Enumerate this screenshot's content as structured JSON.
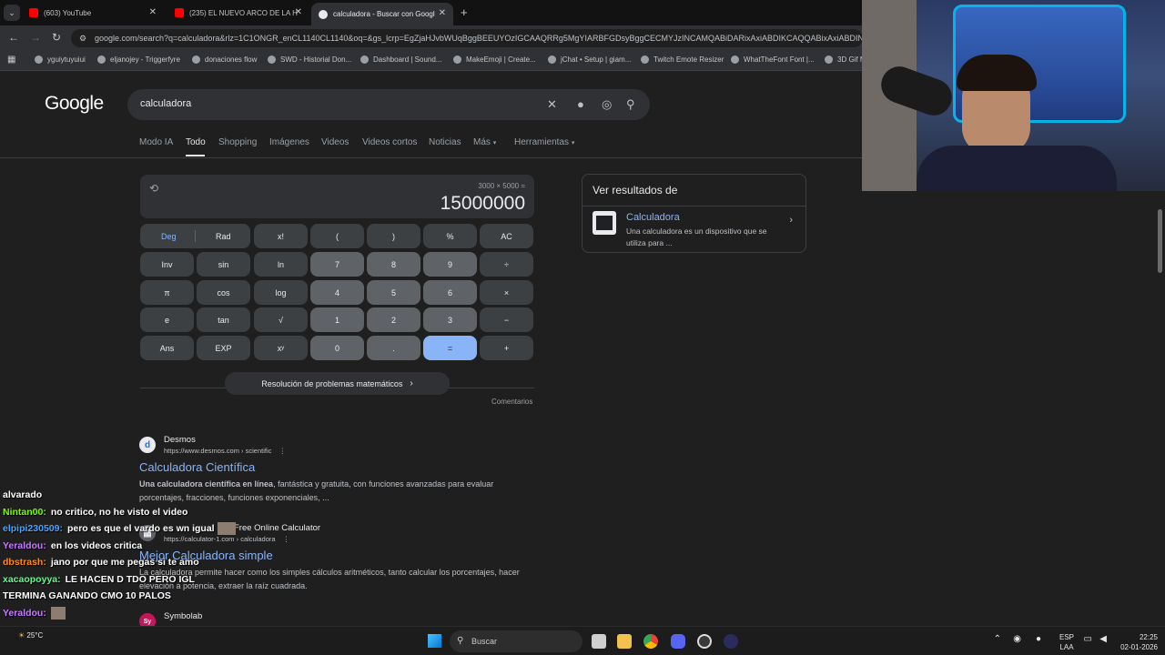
{
  "browser": {
    "tabs": [
      {
        "label": "(603) YouTube",
        "icon": "youtube-icon",
        "active": false
      },
      {
        "label": "(235) EL NUEVO ARCO DE LA H",
        "icon": "youtube-icon",
        "active": false
      },
      {
        "label": "calculadora - Buscar con Googl",
        "icon": "google-icon",
        "active": true
      }
    ],
    "url": "google.com/search?q=calculadora&rlz=1C1ONGR_enCL1140CL1140&oq=&gs_lcrp=EgZjaHJvbWUqBggBEEUYOzIGCAAQRRg5MgYIARBFGDsyBggCECMYJzINCAMQABiDARixAxiABDIKCAQQABixAxiABDINCA",
    "bookmarks": [
      "yguiytuyuiui",
      "eljanojey - Triggerfyre",
      "donaciones flow",
      "SWD - Historial Don...",
      "Dashboard | Sound...",
      "MakeEmoji | Create...",
      "jChat • Setup | giam...",
      "Twitch Emote Resizer",
      "WhatTheFont Font |...",
      "3D Gif M"
    ]
  },
  "google": {
    "logo": "Google",
    "query": "calculadora",
    "tabs": [
      "Modo IA",
      "Todo",
      "Shopping",
      "Imágenes",
      "Videos",
      "Videos cortos",
      "Noticias",
      "Más",
      "Herramientas"
    ],
    "active_tab": "Todo"
  },
  "calculator": {
    "expression": "3000 × 5000 =",
    "result": "15000000",
    "keys": {
      "deg": "Deg",
      "rad": "Rad",
      "fact": "x!",
      "lparen": "(",
      "rparen": ")",
      "percent": "%",
      "ac": "AC",
      "inv": "Inv",
      "sin": "sin",
      "ln": "ln",
      "k7": "7",
      "k8": "8",
      "k9": "9",
      "div": "÷",
      "pi": "π",
      "cos": "cos",
      "log": "log",
      "k4": "4",
      "k5": "5",
      "k6": "6",
      "mul": "×",
      "e": "e",
      "tan": "tan",
      "sqrt": "√",
      "k1": "1",
      "k2": "2",
      "k3": "3",
      "minus": "−",
      "ans": "Ans",
      "exp": "EXP",
      "pow": "xʸ",
      "k0": "0",
      "dot": ".",
      "eq": "=",
      "plus": "+"
    },
    "solve_label": "Resolución de problemas matemáticos",
    "feedback": "Comentarios"
  },
  "knowledge_panel": {
    "heading": "Ver resultados de",
    "title": "Calculadora",
    "desc": "Una calculadora es un dispositivo que se utiliza para ..."
  },
  "results": [
    {
      "site": "Desmos",
      "url": "https://www.desmos.com › scientific",
      "title": "Calculadora Científica",
      "snippet_bold": "Una calculadora científica en línea",
      "snippet": ", fantástica y gratuita, con funciones avanzadas para evaluar porcentajes, fracciones, funciones exponenciales, ..."
    },
    {
      "site": "Free Online Calculator",
      "url": "https://calculator-1.com › calculadora",
      "title": "Mejor Calculadora simple",
      "snippet": "La calculadora permite hacer como los simples cálculos aritméticos, tanto calcular los porcentajes, hacer elevación a potencia, extraer la raíz cuadrada."
    },
    {
      "site": "Symbolab"
    }
  ],
  "chat": [
    {
      "user": "alvarado",
      "color": "#ffffff",
      "msg": ""
    },
    {
      "user": "Nintan00:",
      "color": "#7cfc00",
      "msg": "no critico, no he visto el video"
    },
    {
      "user": "elpipi230509:",
      "color": "#4aa3ff",
      "msg": "pero es que el vardo es wn igual"
    },
    {
      "user": "Yeraldou:",
      "color": "#c77dff",
      "msg": "en los videos critica"
    },
    {
      "user": "dbstrash:",
      "color": "#ff8c1a",
      "msg": "jano por que me pegas si te amo"
    },
    {
      "user": "xacaopoyya:",
      "color": "#5cff8a",
      "msg": "LE HACEN D TDO PERO IGL TERMINA GANANDO CMO 10 PALOS"
    },
    {
      "user": "Yeraldou:",
      "color": "#c77dff",
      "msg": ""
    }
  ],
  "taskbar": {
    "search": "Buscar",
    "weather": "25°C",
    "lang": "ESP",
    "lang2": "LAA",
    "time": "22:25",
    "date": "02-01-2026"
  }
}
